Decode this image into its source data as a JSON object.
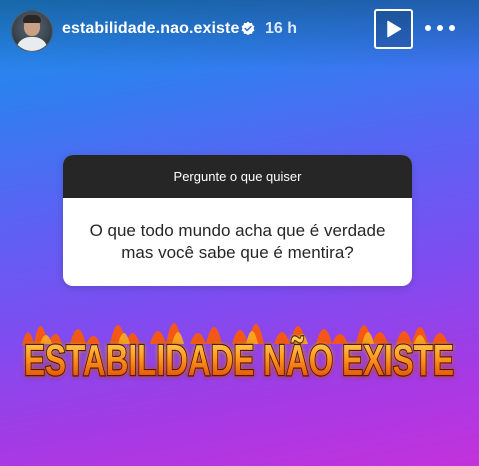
{
  "header": {
    "username": "estabilidade.nao.existe",
    "time": "16 h"
  },
  "question": {
    "prompt": "Pergunte o que quiser",
    "line1": "O que todo mundo acha que é verdade",
    "line2": "mas você sabe que é mentira?"
  },
  "banner": {
    "text": "ESTABILIDADE NÃO EXISTE"
  },
  "colors": {
    "verified": "#3897f0",
    "fire_text": "#ff8a1f",
    "fire_glow": "#ff3d00",
    "question_header": "#262626"
  },
  "icons": [
    "verified-badge-icon",
    "play-icon",
    "more-options-icon"
  ]
}
